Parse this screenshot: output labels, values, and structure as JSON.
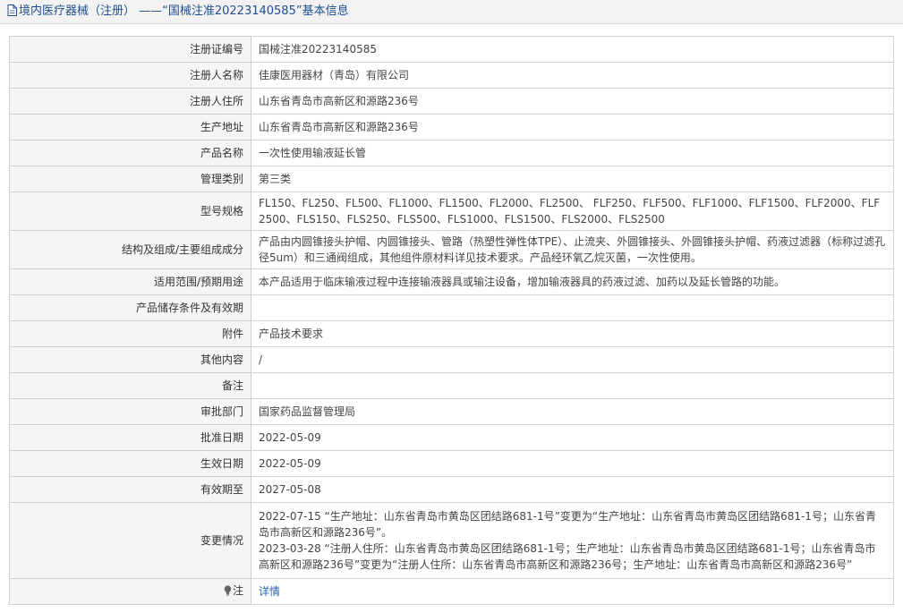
{
  "header": {
    "title": "境内医疗器械（注册） ——“国械注准20223140585”基本信息"
  },
  "rows": [
    {
      "label": "注册证编号",
      "value": "国械注准20223140585"
    },
    {
      "label": "注册人名称",
      "value": "佳康医用器材（青岛）有限公司"
    },
    {
      "label": "注册人住所",
      "value": "山东省青岛市高新区和源路236号"
    },
    {
      "label": "生产地址",
      "value": "山东省青岛市高新区和源路236号"
    },
    {
      "label": "产品名称",
      "value": "一次性使用输液延长管"
    },
    {
      "label": "管理类别",
      "value": "第三类"
    },
    {
      "label": "型号规格",
      "value": "FL150、FL250、FL500、FL1000、FL1500、FL2000、FL2500、 FLF250、FLF500、FLF1000、FLF1500、FLF2000、FLF2500、FLS150、FLS250、FLS500、FLS1000、FLS1500、FLS2000、FLS2500"
    },
    {
      "label": "结构及组成/主要组成成分",
      "value": "产品由内圆锥接头护帽、内圆锥接头、管路（热塑性弹性体TPE）、止流夹、外圆锥接头、外圆锥接头护帽、药液过滤器（标称过滤孔径5um）和三通阀组成，其他组件原材料详见技术要求。产品经环氧乙烷灭菌，一次性使用。"
    },
    {
      "label": "适用范围/预期用途",
      "value": "本产品适用于临床输液过程中连接输液器具或输注设备，增加输液器具的药液过滤、加药以及延长管路的功能。"
    },
    {
      "label": "产品储存条件及有效期",
      "value": ""
    },
    {
      "label": "附件",
      "value": "产品技术要求"
    },
    {
      "label": "其他内容",
      "value": "/"
    },
    {
      "label": "备注",
      "value": ""
    },
    {
      "label": "审批部门",
      "value": "国家药品监督管理局"
    },
    {
      "label": "批准日期",
      "value": "2022-05-09"
    },
    {
      "label": "生效日期",
      "value": "2022-05-09"
    },
    {
      "label": "有效期至",
      "value": "2027-05-08"
    },
    {
      "label": "变更情况",
      "value_lines": [
        "2022-07-15 “生产地址：山东省青岛市黄岛区团结路681-1号”变更为“生产地址：山东省青岛市黄岛区团结路681-1号；山东省青岛市高新区和源路236号”。",
        "2023-03-28 “注册人住所：山东省青岛市黄岛区团结路681-1号；生产地址：山东省青岛市黄岛区团结路681-1号；山东省青岛市高新区和源路236号”变更为“注册人住所：山东省青岛市高新区和源路236号；生产地址：山东省青岛市高新区和源路236号”"
      ]
    },
    {
      "label": "注",
      "value": "详情"
    }
  ],
  "icons": {
    "header": "document-icon",
    "note": "lightbulb-icon"
  },
  "colors": {
    "header_text": "#1f4e91",
    "link": "#2a63b8",
    "label_bg": "#f5f5f5"
  }
}
